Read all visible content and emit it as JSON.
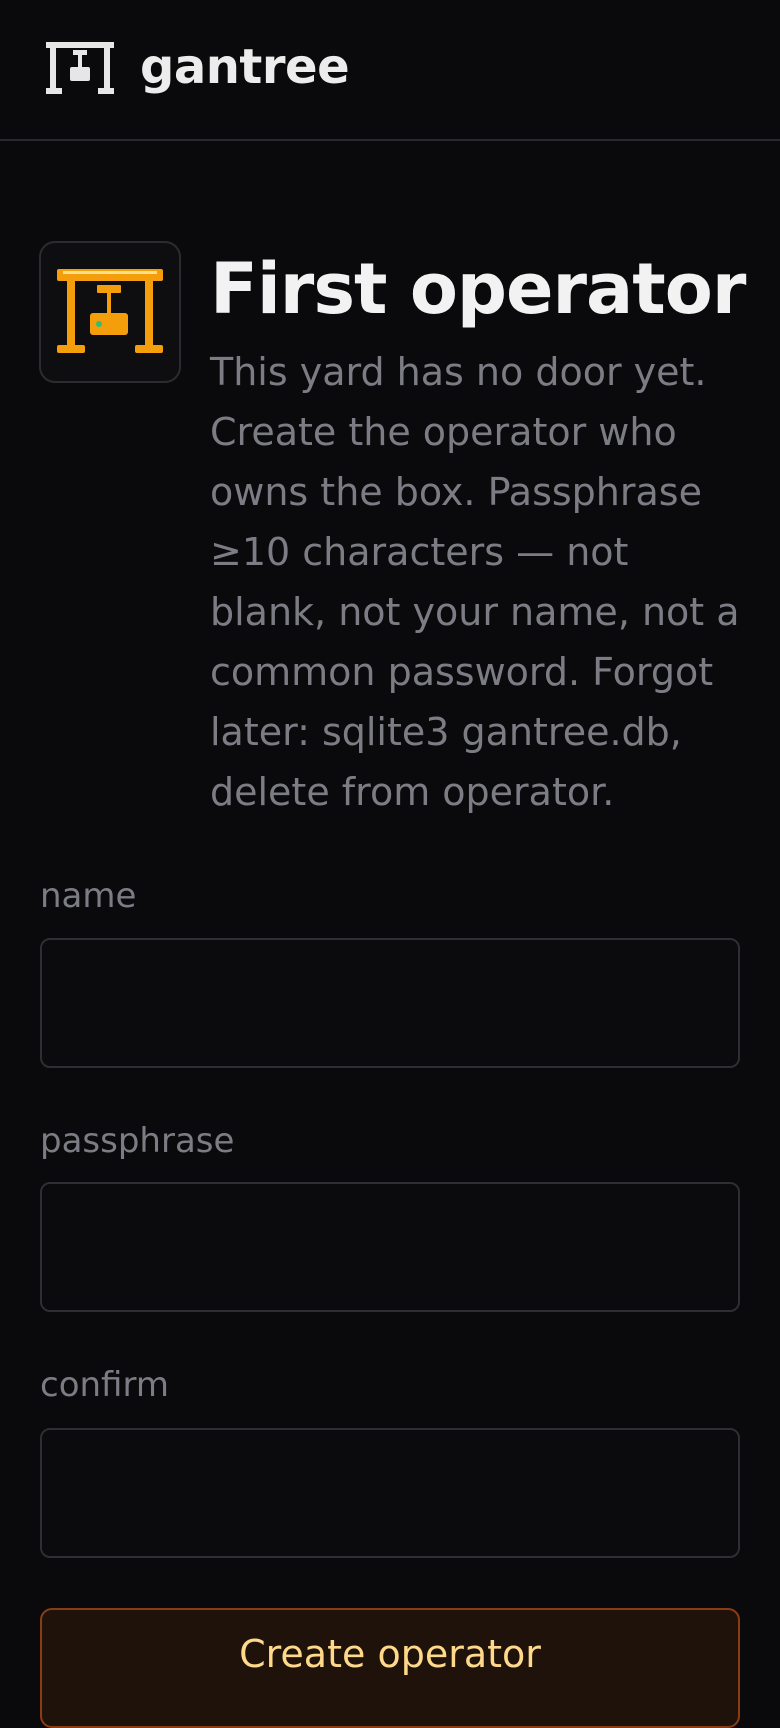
{
  "header": {
    "brand_icon": "gantry-crane-icon",
    "brand_name": "gantree"
  },
  "hero": {
    "icon": "gantry-crane-icon",
    "icon_color": "#f59e0b",
    "title": "First operator",
    "description": "This yard has no door yet. Create the operator who owns the box. Passphrase ≥10 characters — not blank, not your name, not a common password. Forgot later: sqlite3 gantree.db, delete from operator."
  },
  "form": {
    "name": {
      "label": "name",
      "value": ""
    },
    "passphrase": {
      "label": "passphrase",
      "value": ""
    },
    "confirm": {
      "label": "confirm",
      "value": ""
    },
    "submit_label": "Create operator"
  },
  "colors": {
    "background": "#0a0a0c",
    "accent": "#f59e0b",
    "button_border": "#8a3d12",
    "button_text": "#ffd98a",
    "indicator": "#2fbf71"
  }
}
